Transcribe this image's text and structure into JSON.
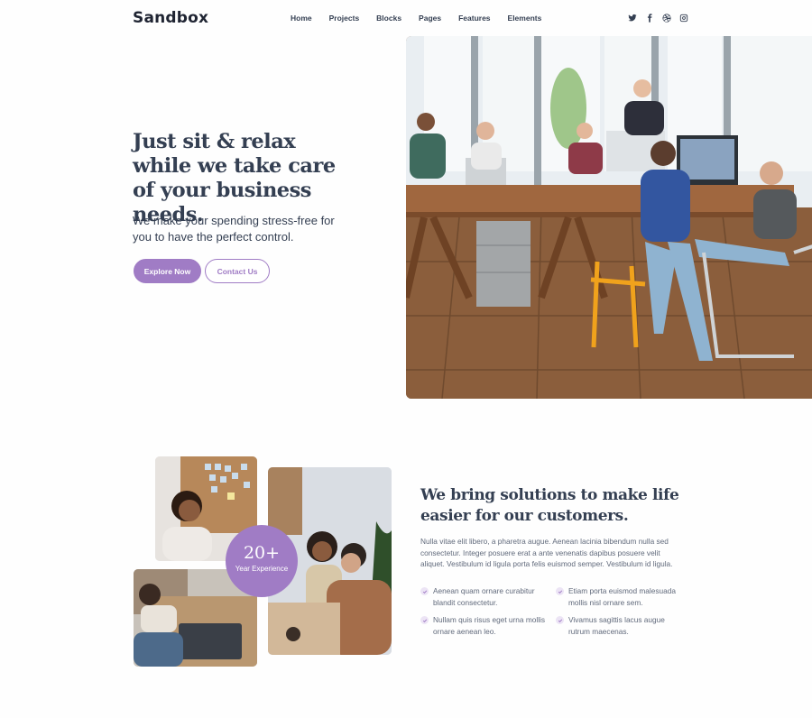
{
  "header": {
    "logo": "Sandbox",
    "nav": [
      "Home",
      "Projects",
      "Blocks",
      "Pages",
      "Features",
      "Elements"
    ],
    "social_icons": [
      "twitter-icon",
      "facebook-icon",
      "dribbble-icon",
      "instagram-icon"
    ]
  },
  "hero": {
    "title": "Just sit & relax while we take care of your business needs.",
    "lead": "We make your spending stress-free for you to have the perfect control.",
    "primary_button": "Explore Now",
    "secondary_button": "Contact Us"
  },
  "about": {
    "badge_number": "20+",
    "badge_label": "Year Experience",
    "title": "We bring solutions to make life easier for our customers.",
    "text": "Nulla vitae elit libero, a pharetra augue. Aenean lacinia bibendum nulla sed consectetur. Integer posuere erat a ante venenatis dapibus posuere velit aliquet. Vestibulum id ligula porta felis euismod semper. Vestibulum id ligula.",
    "features": [
      "Aenean quam ornare curabitur blandit consectetur.",
      "Etiam porta euismod malesuada mollis nisl ornare sem.",
      "Nullam quis risus eget urna mollis ornare aenean leo.",
      "Vivamus sagittis lacus augue rutrum maecenas."
    ]
  },
  "colors": {
    "accent": "#a07cc5",
    "heading": "#343f52",
    "body_text": "#60697b"
  }
}
